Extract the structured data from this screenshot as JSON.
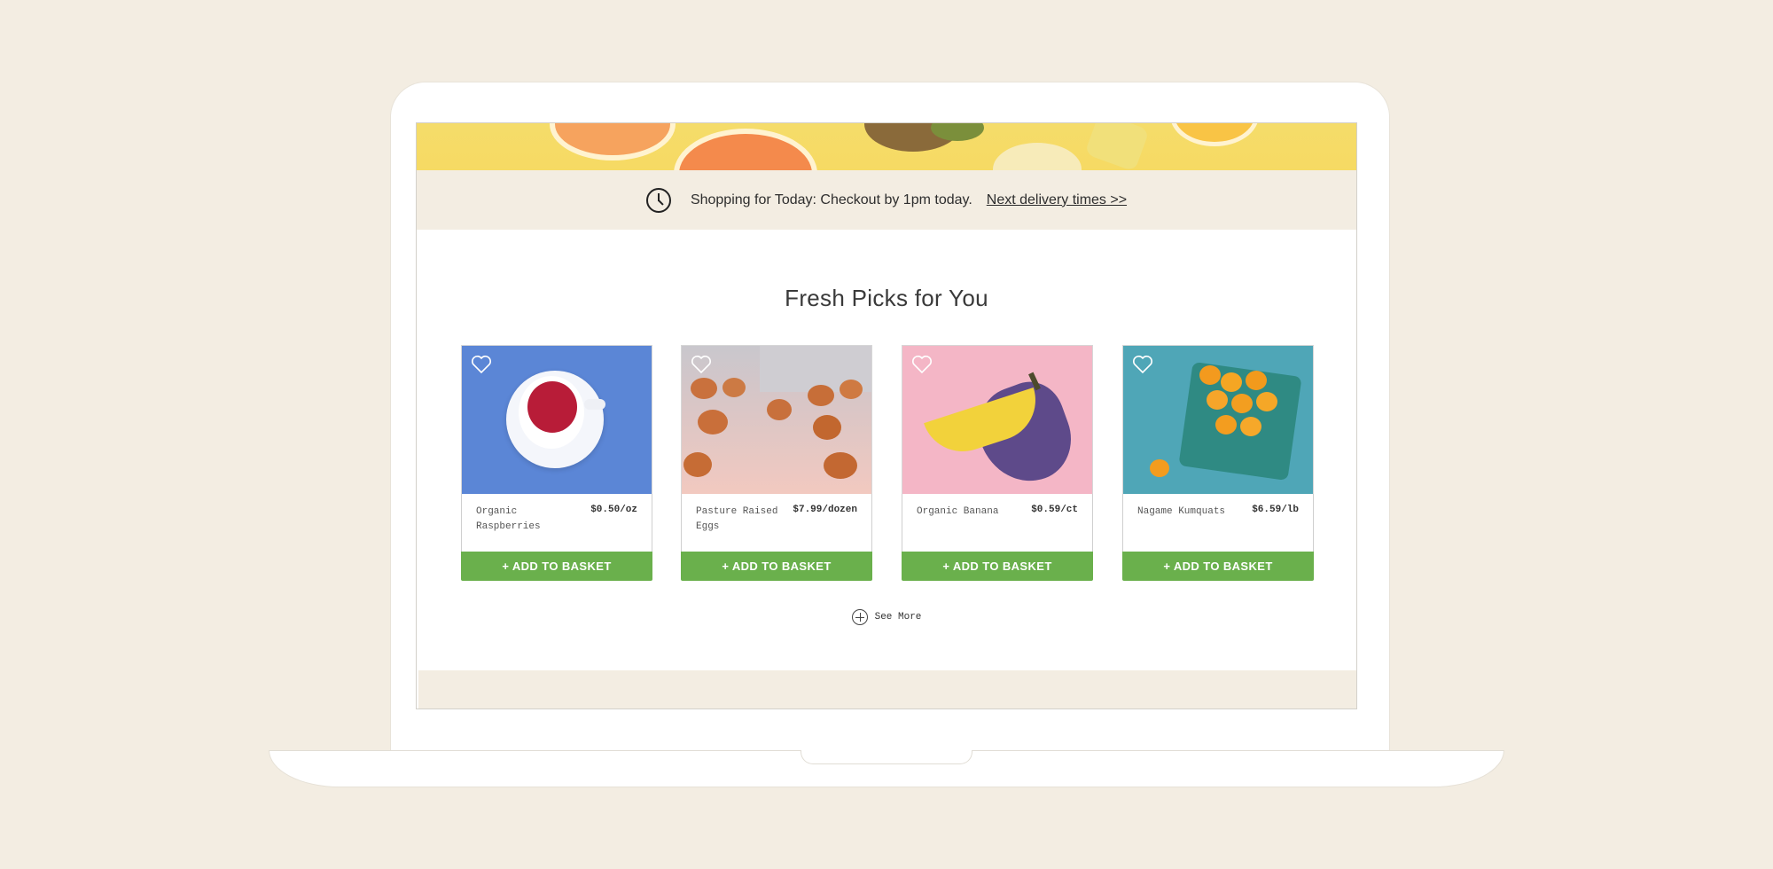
{
  "promo": {
    "text": "Shopping for Today: Checkout by 1pm today.",
    "link": "Next delivery times >>",
    "icon": "clock-icon"
  },
  "section": {
    "title": "Fresh Picks for You"
  },
  "products": [
    {
      "name": "Organic Raspberries",
      "price": "$0.50/oz",
      "button": "+ ADD TO BASKET"
    },
    {
      "name": "Pasture Raised Eggs",
      "price": "$7.99/dozen",
      "button": "+ ADD TO BASKET"
    },
    {
      "name": "Organic Banana",
      "price": "$0.59/ct",
      "button": "+ ADD TO BASKET"
    },
    {
      "name": "Nagame Kumquats",
      "price": "$6.59/lb",
      "button": "+ ADD TO BASKET"
    }
  ],
  "see_more": {
    "label": "See More"
  },
  "colors": {
    "background": "#f3ede2",
    "accent_green": "#6ab04c",
    "hero_yellow": "#f6da63"
  }
}
